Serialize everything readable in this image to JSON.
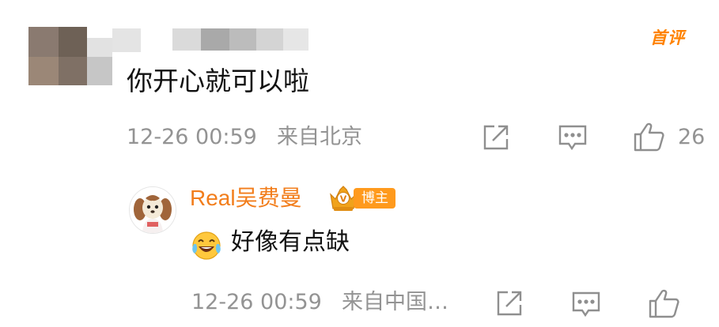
{
  "comment": {
    "badge": "首评",
    "text": "你开心就可以啦",
    "time": "12-26 00:59",
    "location": "来自北京",
    "like_count": "26",
    "icons": [
      "share-icon",
      "reply-icon",
      "like-icon"
    ]
  },
  "reply": {
    "username": "Real吴费曼",
    "role_badge": "博主",
    "emoji": "laughing-tears-emoji",
    "text": "好像有点缺",
    "time": "12-26 00:59",
    "location": "来自中国…",
    "icons": [
      "share-icon",
      "reply-icon",
      "like-icon"
    ]
  },
  "colors": {
    "accent": "#ff8200",
    "username": "#f27d1b",
    "meta": "#939393",
    "text": "#111111",
    "badge_bg": "#ff9a1d"
  }
}
